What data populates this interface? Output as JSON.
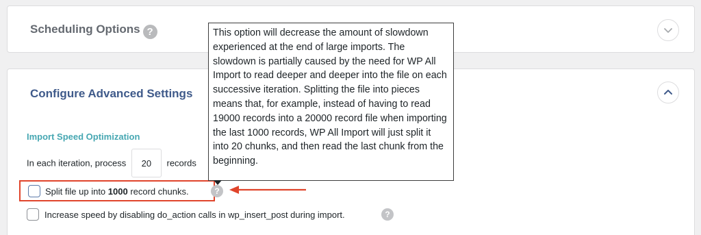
{
  "scheduling": {
    "title": "Scheduling Options",
    "help_glyph": "?",
    "toggle_icon": "chevron-down-icon"
  },
  "advanced": {
    "title": "Configure Advanced Settings",
    "toggle_icon": "chevron-up-icon",
    "section_heading": "Import Speed Optimization",
    "iteration": {
      "prefix": "In each iteration, process",
      "value": "20",
      "suffix": "records"
    },
    "split": {
      "label_prefix": "Split file up into ",
      "label_count": "1000",
      "label_suffix": " record chunks.",
      "checked": false,
      "help_glyph": "?"
    },
    "speed": {
      "label": "Increase speed by disabling do_action calls in wp_insert_post during import.",
      "checked": false,
      "help_glyph": "?"
    }
  },
  "tooltip": {
    "text": "This option will decrease the amount of slowdown experienced at the end of large imports. The slowdown is partially caused by the need for WP All Import to read deeper and deeper into the file on each successive iteration. Splitting the file into pieces means that, for example, instead of having to read 19000 records into a 20000 record file when importing the last 1000 records, WP All Import will just split it into 20 chunks, and then read the last chunk from the beginning."
  },
  "colors": {
    "highlight": "#e0442b",
    "title_blue": "#3f5a8a",
    "section_teal": "#46a7b2"
  }
}
